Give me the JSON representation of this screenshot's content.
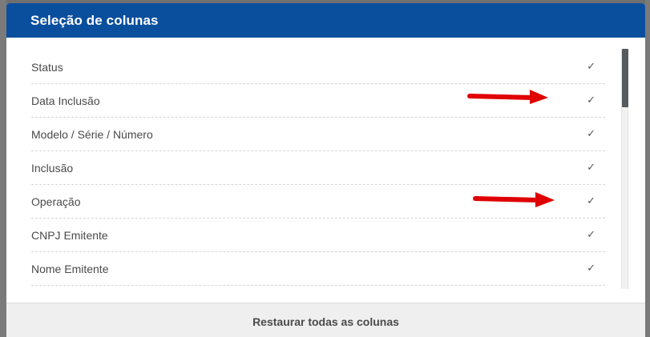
{
  "modal": {
    "title": "Seleção de colunas",
    "columns": [
      {
        "label": "Status",
        "checked": true
      },
      {
        "label": "Data Inclusão",
        "checked": true
      },
      {
        "label": "Modelo / Série / Número",
        "checked": true
      },
      {
        "label": "Inclusão",
        "checked": true
      },
      {
        "label": "Operação",
        "checked": true
      },
      {
        "label": "CNPJ Emitente",
        "checked": true
      },
      {
        "label": "Nome Emitente",
        "checked": true
      }
    ],
    "check_glyph": "✓",
    "restore_label": "Restaurar todas as colunas"
  },
  "colors": {
    "header": "#0a4f9e",
    "arrow": "#e00000",
    "footer": "#efefef"
  }
}
